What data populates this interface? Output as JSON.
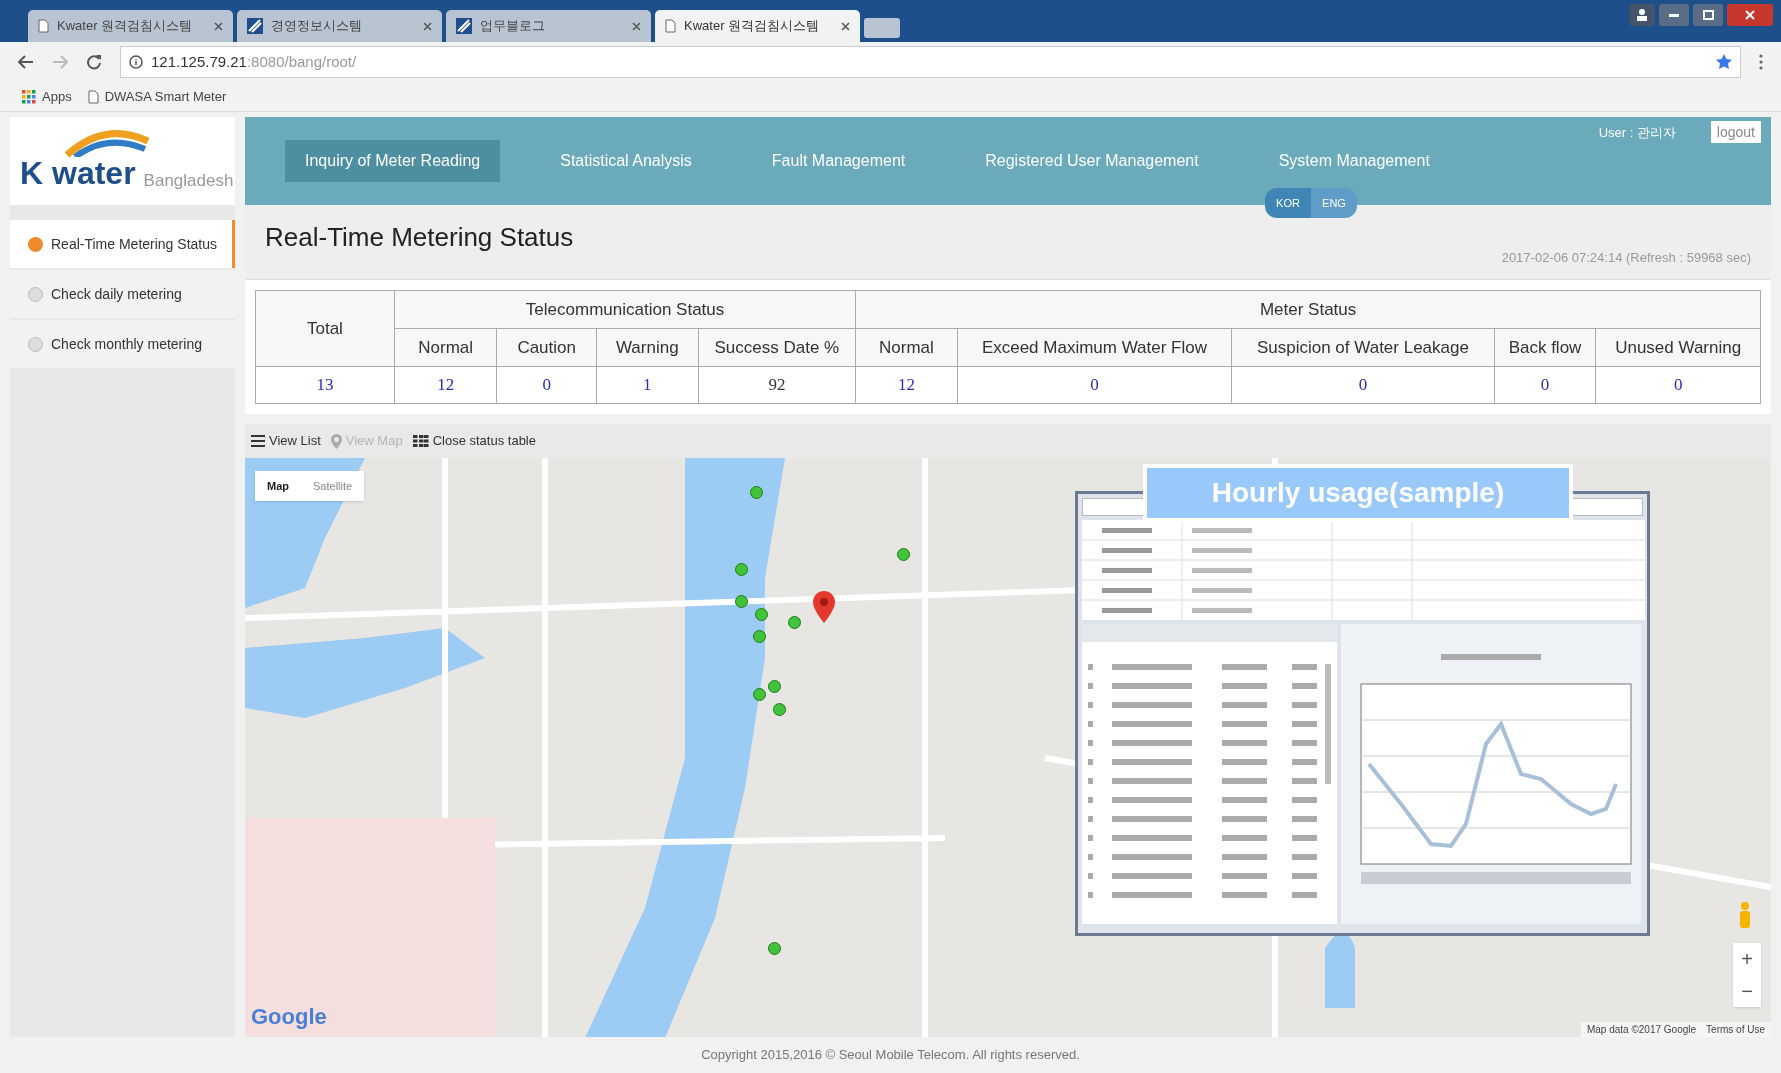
{
  "browser": {
    "tabs": [
      {
        "title": "Kwater 원격검침시스템",
        "kind": "page",
        "selected": false
      },
      {
        "title": "경영정보시스템",
        "kind": "app",
        "selected": false
      },
      {
        "title": "업무블로그",
        "kind": "app",
        "selected": false
      },
      {
        "title": "Kwater 원격검침시스템",
        "kind": "page",
        "selected": true
      }
    ],
    "url_host": "121.125.79.21",
    "url_path": ":8080/bang/root/",
    "bookmarks": [
      {
        "label": "Apps",
        "kind": "apps"
      },
      {
        "label": "DWASA Smart Meter",
        "kind": "page"
      }
    ]
  },
  "header": {
    "logo": {
      "brand_k": "K",
      "brand_rest": "water",
      "region": "Bangladesh"
    },
    "nav": [
      {
        "label": "Inquiry of Meter Reading",
        "selected": true
      },
      {
        "label": "Statistical Analysis",
        "selected": false
      },
      {
        "label": "Fault Management",
        "selected": false
      },
      {
        "label": "Registered User Management",
        "selected": false
      },
      {
        "label": "System Management",
        "selected": false
      }
    ],
    "user": "User : 관리자",
    "logout": "logout",
    "languages": [
      {
        "label": "KOR",
        "selected": true
      },
      {
        "label": "ENG",
        "selected": false
      }
    ]
  },
  "sidebar": {
    "items": [
      {
        "label": "Real-Time Metering Status",
        "selected": true
      },
      {
        "label": "Check daily metering",
        "selected": false
      },
      {
        "label": "Check monthly metering",
        "selected": false
      }
    ]
  },
  "page": {
    "title": "Real-Time Metering Status",
    "timestamp": "2017-02-06 07:24:14 (Refresh : 59968 sec)"
  },
  "status_table": {
    "total_label": "Total",
    "groups": [
      {
        "title": "Telecommunication Status",
        "columns": [
          "Normal",
          "Caution",
          "Warning",
          "Success Date %"
        ]
      },
      {
        "title": "Meter Status",
        "columns": [
          "Normal",
          "Exceed Maximum Water Flow",
          "Suspicion of Water Leakage",
          "Back flow",
          "Unused Warning"
        ]
      }
    ],
    "values": [
      {
        "text": "13",
        "link": true
      },
      {
        "text": "12",
        "link": true
      },
      {
        "text": "0",
        "link": true
      },
      {
        "text": "1",
        "link": true
      },
      {
        "text": "92",
        "link": false
      },
      {
        "text": "12",
        "link": true
      },
      {
        "text": "0",
        "link": true
      },
      {
        "text": "0",
        "link": true
      },
      {
        "text": "0",
        "link": true
      },
      {
        "text": "0",
        "link": true
      }
    ]
  },
  "toolbar": [
    {
      "label": "View List",
      "kind": "list",
      "disabled": false
    },
    {
      "label": "View Map",
      "kind": "pin",
      "disabled": true
    },
    {
      "label": "Close status table",
      "kind": "grid",
      "disabled": false
    }
  ],
  "map": {
    "types": [
      {
        "label": "Map",
        "selected": true
      },
      {
        "label": "Satellite",
        "selected": false
      }
    ],
    "logo": "Google",
    "attribution": "Map data ©2017 Google",
    "terms": "Terms of Use",
    "zoom_in": "+",
    "zoom_out": "−",
    "inset": {
      "banner": "Hourly usage(sample)"
    }
  },
  "footer": {
    "copyright": "Copyright 2015,2016 © Seoul Mobile Telecom. All rights reserved."
  }
}
